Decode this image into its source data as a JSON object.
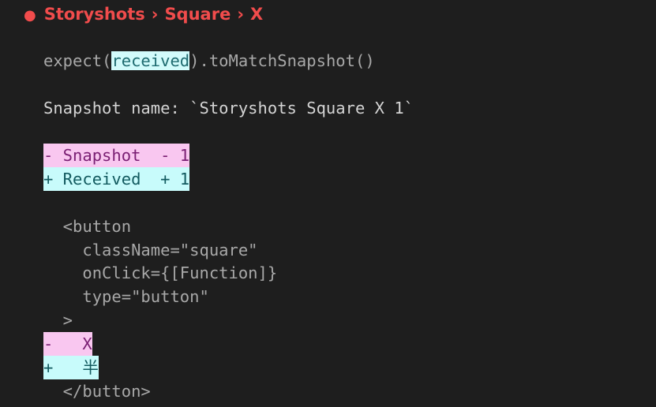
{
  "header": {
    "bullet": "●",
    "crumb1": "Storyshots",
    "sep": "›",
    "crumb2": "Square",
    "crumb3": "X"
  },
  "assertion": {
    "pre": "expect(",
    "received": "received",
    "post": ").toMatchSnapshot()"
  },
  "snapshot_name": "Snapshot name: `Storyshots Square X 1`",
  "legend": {
    "snapshot": "- Snapshot  - 1",
    "received": "+ Received  + 1"
  },
  "diff": {
    "open_tag": "  <button",
    "attr1": "    className=\"square\"",
    "attr2": "    onClick={[Function]}",
    "attr3": "    type=\"button\"",
    "close_bracket": "  >",
    "removed": "-   X",
    "added": "+   半",
    "close_tag": "  </button>"
  }
}
